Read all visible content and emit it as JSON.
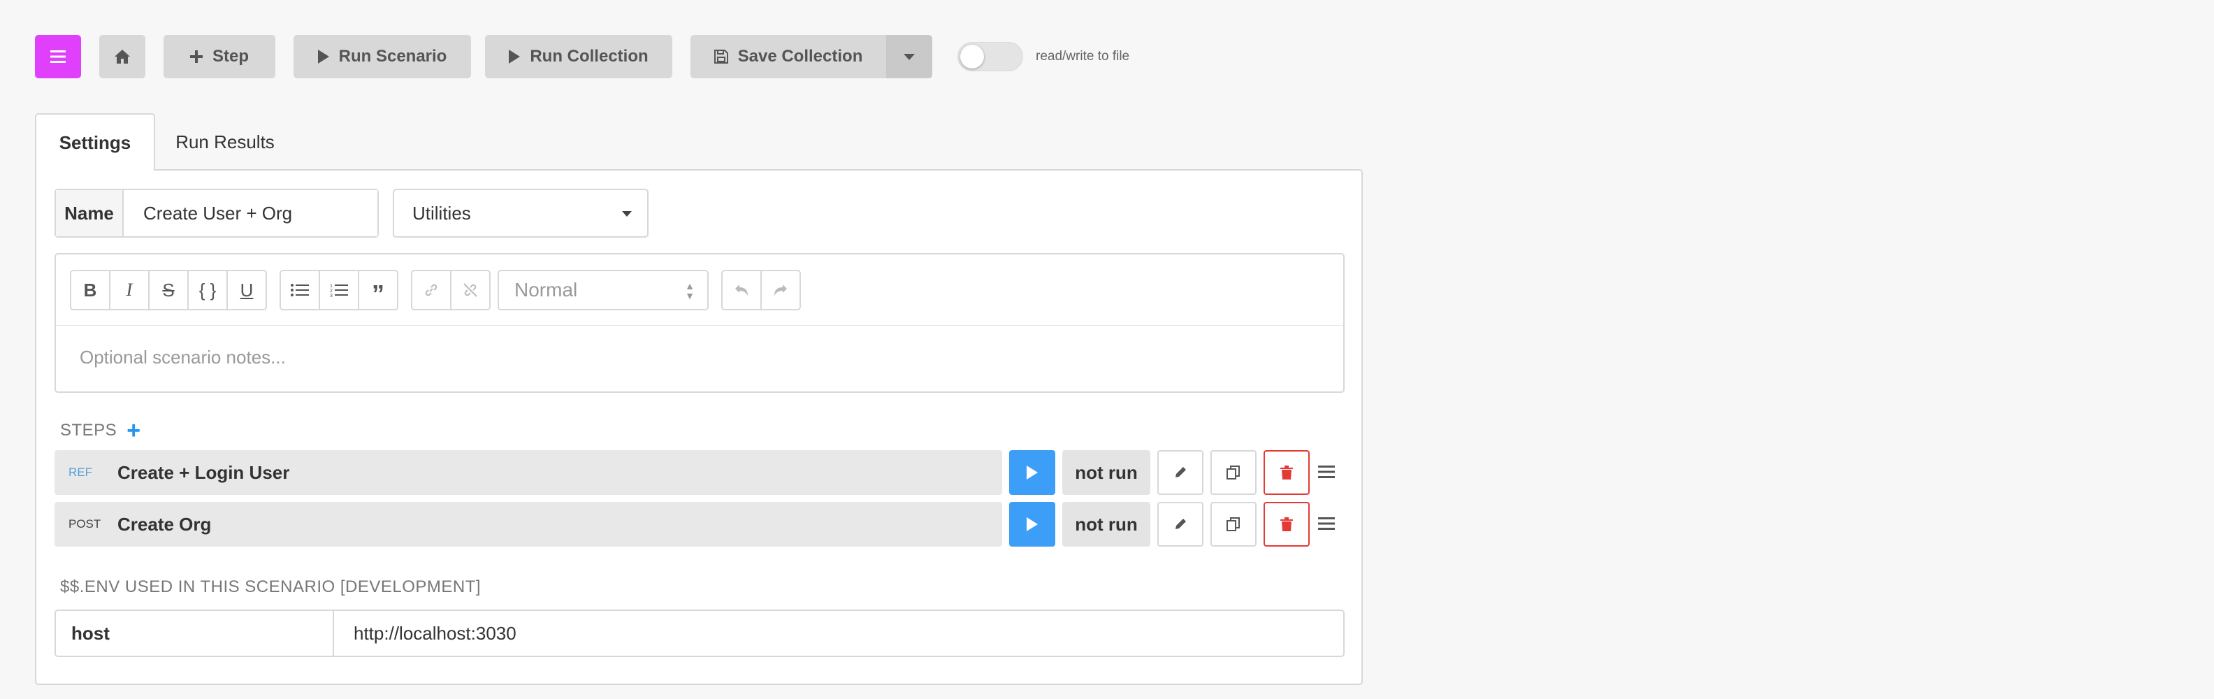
{
  "toolbar": {
    "step_label": "Step",
    "run_scenario_label": "Run Scenario",
    "run_collection_label": "Run Collection",
    "save_collection_label": "Save Collection",
    "toggle_label": "read/write to file",
    "toggle_on": false,
    "menu_color": "#e040fb"
  },
  "tabs": [
    {
      "label": "Settings",
      "active": true
    },
    {
      "label": "Run Results",
      "active": false
    }
  ],
  "settings": {
    "name_label": "Name",
    "name_value": "Create User + Org",
    "category_selected": "Utilities",
    "editor": {
      "format_selected": "Normal",
      "notes_placeholder": "Optional scenario notes..."
    }
  },
  "steps": {
    "header": "STEPS",
    "items": [
      {
        "method": "REF",
        "name": "Create + Login User",
        "status": "not run"
      },
      {
        "method": "POST",
        "name": "Create Org",
        "status": "not run"
      }
    ]
  },
  "env": {
    "header": "$$.ENV USED IN THIS SCENARIO [DEVELOPMENT]",
    "rows": [
      {
        "key": "host",
        "value": "http://localhost:3030"
      }
    ]
  },
  "colors": {
    "play": "#3d9ef7",
    "delete": "#e53935",
    "ref_method": "#5aa0d6"
  }
}
